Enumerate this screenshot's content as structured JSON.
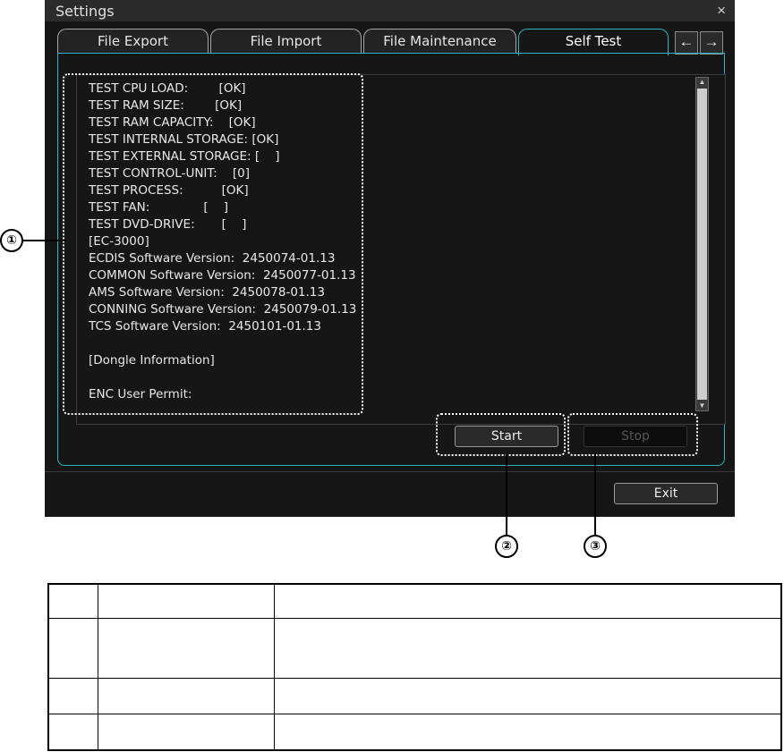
{
  "window": {
    "title": "Settings",
    "close_glyph": "×"
  },
  "tabs": [
    {
      "label": "File Export"
    },
    {
      "label": "File Import"
    },
    {
      "label": "File Maintenance"
    },
    {
      "label": "Self Test",
      "active": true
    }
  ],
  "nav_arrows": {
    "left": "←",
    "right": "→"
  },
  "results": [
    "TEST CPU LOAD:        [OK]",
    "TEST RAM SIZE:        [OK]",
    "TEST RAM CAPACITY:    [OK]",
    "TEST INTERNAL STORAGE: [OK]",
    "TEST EXTERNAL STORAGE: [    ]",
    "TEST CONTROL-UNIT:    [0]",
    "TEST PROCESS:          [OK]",
    "TEST FAN:              [    ]",
    "TEST DVD-DRIVE:       [    ]",
    "[EC-3000]",
    "ECDIS Software Version:  2450074-01.13",
    "COMMON Software Version:  2450077-01.13",
    "AMS Software Version:  2450078-01.13",
    "CONNING Software Version:  2450079-01.13",
    "TCS Software Version:  2450101-01.13",
    "",
    "[Dongle Information]",
    "",
    "ENC User Permit:"
  ],
  "buttons": {
    "start": "Start",
    "stop": "Stop",
    "exit": "Exit"
  },
  "callouts": [
    "①",
    "②",
    "③"
  ],
  "legend_rows": [
    [
      "",
      "",
      ""
    ],
    [
      "",
      "",
      ""
    ],
    [
      "",
      "",
      ""
    ],
    [
      "",
      "",
      ""
    ]
  ],
  "colors": {
    "accent": "#2fb4c4",
    "background": "#161616"
  }
}
